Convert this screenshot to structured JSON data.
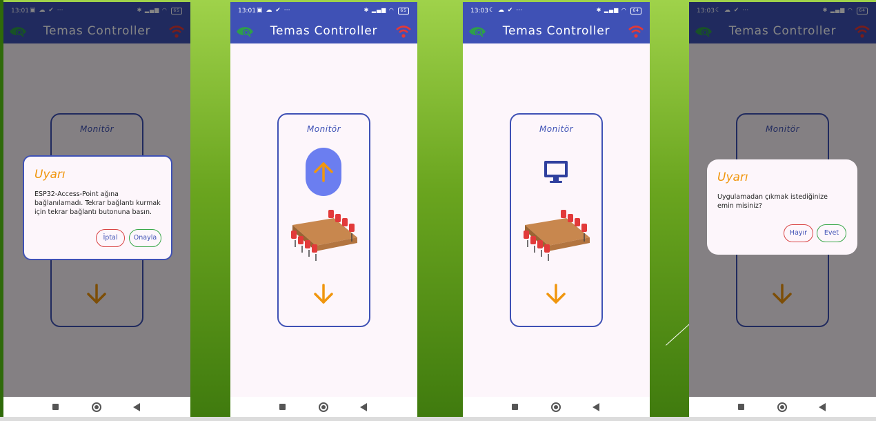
{
  "app": {
    "title": "Temas Controller"
  },
  "screens": [
    {
      "status_time": "13:01",
      "card_label": "Monitör",
      "dialog": {
        "title": "Uyarı",
        "message": "ESP32-Access-Point ağına bağlanılamadı. Tekrar bağlantı kurmak için tekrar bağlantı butonuna basın.",
        "cancel_label": "İptal",
        "confirm_label": "Onayla"
      }
    },
    {
      "status_time": "13:01",
      "card_label": "Monitör"
    },
    {
      "status_time": "13:03",
      "card_label": "Monitör"
    },
    {
      "status_time": "13:03",
      "card_label": "Monitör",
      "dialog": {
        "title": "Uyarı",
        "message": "Uygulamadan çıkmak istediğinize emin misiniz?",
        "cancel_label": "Hayır",
        "confirm_label": "Evet"
      }
    }
  ],
  "status": {
    "battery": "65",
    "battery_alt": "64"
  },
  "icons": {
    "logo": "eye-logo-icon",
    "wifi": "wifi-icon",
    "up": "arrow-up-icon",
    "down": "arrow-down-icon",
    "monitor": "monitor-icon",
    "table": "meeting-table-icon"
  },
  "colors": {
    "primary": "#3f51b5",
    "accent": "#f0960e",
    "wifi_red": "#e53935",
    "logo_green": "#2e9e4a",
    "chair_red": "#e23a3a",
    "table_brown": "#c8874e",
    "up_button": "#6b7ef0"
  }
}
